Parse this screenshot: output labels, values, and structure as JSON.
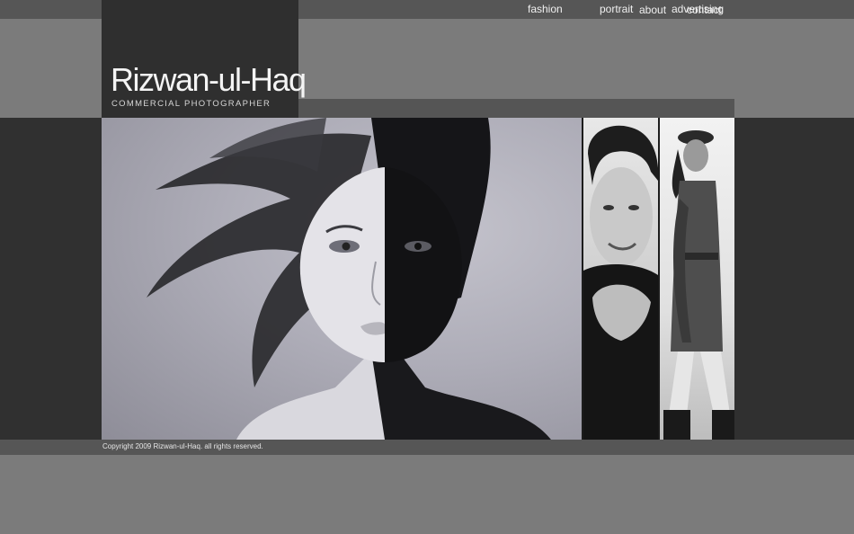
{
  "site": {
    "name": "Rizwan-ul-Haq",
    "tagline": "COMMERCIAL PHOTOGRAPHER"
  },
  "top_nav": [
    {
      "label": "about"
    },
    {
      "label": "contact"
    }
  ],
  "category_nav": [
    {
      "label": "fashion"
    },
    {
      "label": "portrait"
    },
    {
      "label": "advertising"
    }
  ],
  "footer": {
    "copyright": "Copyright 2009 Rizwan-ul-Haq. all rights reserved."
  },
  "colors": {
    "page_bg": "#7b7b7b",
    "bar_bg": "#565656",
    "logo_bg": "#2f2f2f",
    "band_bg": "#303030",
    "text_light": "#f0f0f0"
  }
}
